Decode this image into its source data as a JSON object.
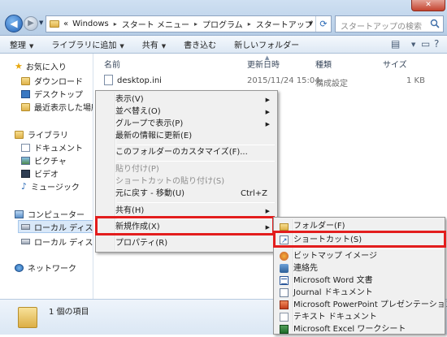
{
  "window": {
    "close_label": "✕",
    "address": {
      "overflow": "«",
      "parts": [
        "Windows",
        "スタート メニュー",
        "プログラム",
        "スタートアップ"
      ]
    },
    "search_placeholder": "スタートアップの検索"
  },
  "toolbar": {
    "organize": "整理",
    "include_library": "ライブラリに追加",
    "share": "共有",
    "burn": "書き込む",
    "new_folder": "新しいフォルダー"
  },
  "nav": {
    "favorites": "お気に入り",
    "downloads": "ダウンロード",
    "desktop": "デスクトップ",
    "recent": "最近表示した場所",
    "libraries": "ライブラリ",
    "documents": "ドキュメント",
    "pictures": "ピクチャ",
    "videos": "ビデオ",
    "music": "ミュージック",
    "computer": "コンピューター",
    "local_disk_1": "ローカル ディスク (",
    "local_disk_2": "ローカル ディスク (",
    "network": "ネットワーク"
  },
  "columns": {
    "name": "名前",
    "modified": "更新日時",
    "type": "種類",
    "size": "サイズ"
  },
  "file": {
    "name": "desktop.ini",
    "modified": "2015/11/24 15:04",
    "type": "構成設定",
    "size": "1 KB"
  },
  "status": {
    "count": "1 個の項目"
  },
  "context_menu": {
    "view": "表示(V)",
    "sort_by": "並べ替え(O)",
    "group_by": "グループで表示(P)",
    "refresh": "最新の情報に更新(E)",
    "customize": "このフォルダーのカスタマイズ(F)...",
    "paste": "貼り付け(P)",
    "paste_shortcut": "ショートカットの貼り付け(S)",
    "undo": "元に戻す - 移動(U)",
    "undo_key": "Ctrl+Z",
    "share": "共有(H)",
    "new": "新規作成(X)",
    "properties": "プロパティ(R)"
  },
  "new_submenu": {
    "folder": "フォルダー(F)",
    "shortcut": "ショートカット(S)",
    "bitmap": "ビットマップ イメージ",
    "contact": "連絡先",
    "word": "Microsoft Word 文書",
    "journal": "Journal ドキュメント",
    "powerpoint": "Microsoft PowerPoint プレゼンテーション",
    "text": "テキスト ドキュメント",
    "excel": "Microsoft Excel ワークシート"
  },
  "colors": {
    "highlight": "#e31d1d",
    "accent": "#2c6bb7"
  }
}
